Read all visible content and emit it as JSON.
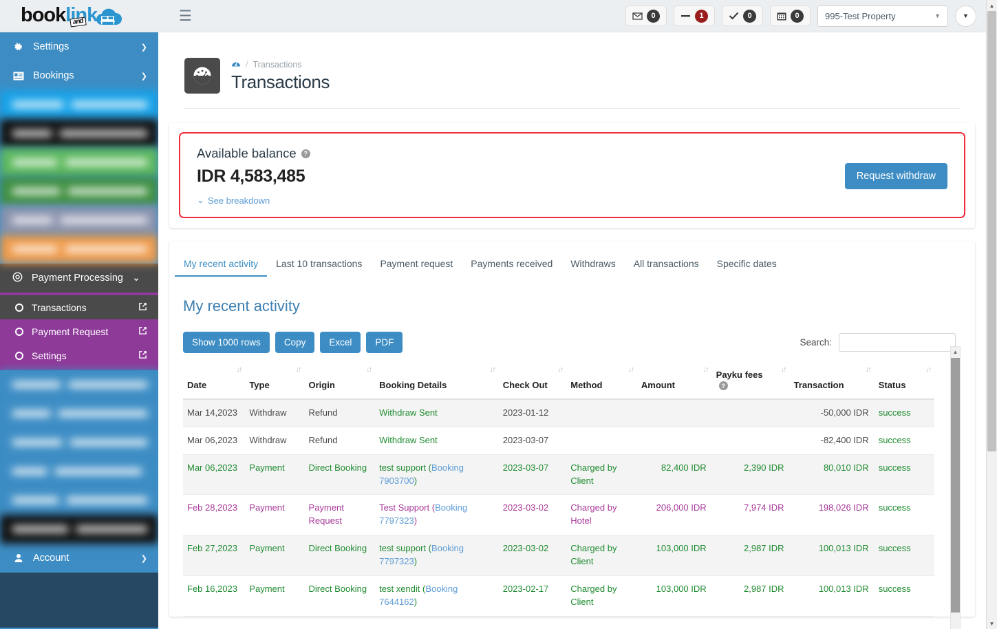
{
  "brand": {
    "book": "book",
    "and": "and",
    "link": "link"
  },
  "topbar": {
    "menu_icon": "hamburger-icon",
    "stats": [
      {
        "icon": "envelope-icon",
        "glyph": "✉",
        "count": "0",
        "style": "dark"
      },
      {
        "icon": "minus-icon",
        "glyph": "➖",
        "count": "1",
        "style": "red"
      },
      {
        "icon": "check-icon",
        "glyph": "✔",
        "count": "0",
        "style": "dark"
      },
      {
        "icon": "calendar-icon",
        "glyph": "Ὄ5",
        "count": "0",
        "style": "dark"
      }
    ],
    "property": {
      "value": "995-Test Property",
      "caret": "▼"
    },
    "extra_button_caret": "▼"
  },
  "sidebar": {
    "items": [
      {
        "label": "Settings",
        "icon": "gear-icon",
        "arrow": "❯"
      },
      {
        "label": "Bookings",
        "icon": "id-card-icon",
        "arrow": "❯"
      }
    ],
    "redacted_top": [
      {
        "bg": "#17a2e8",
        "w1": 78,
        "w2": 116
      },
      {
        "bg": "#111111",
        "w1": 62,
        "w2": 138
      },
      {
        "bg": "#5cb85c",
        "w1": 70,
        "w2": 128
      },
      {
        "bg": "#3f8f3f",
        "w1": 74,
        "w2": 122
      },
      {
        "bg": "#8b93ad",
        "w1": 60,
        "w2": 130
      },
      {
        "bg": "#ef9a4a",
        "w1": 66,
        "w2": 120
      }
    ],
    "group": {
      "label": "Payment Processing",
      "icon": "target-icon",
      "chevron": "⌄",
      "items": [
        {
          "label": "Transactions",
          "active": true,
          "ext_icon": "external-link-icon"
        },
        {
          "label": "Payment Request",
          "active": false,
          "ext_icon": "external-link-icon"
        },
        {
          "label": "Settings",
          "active": false,
          "ext_icon": "external-link-icon"
        }
      ]
    },
    "redacted_bottom": [
      {
        "bg": "#3d8dc4",
        "w1": 72,
        "w2": 118
      },
      {
        "bg": "#3d8dc4",
        "w1": 56,
        "w2": 132
      },
      {
        "bg": "#3d8dc4",
        "w1": 80,
        "w2": 124
      },
      {
        "bg": "#3d8dc4",
        "w1": 50,
        "w2": 126
      },
      {
        "bg": "#3d8dc4",
        "w1": 68,
        "w2": 120
      },
      {
        "bg": "#111111",
        "w1": 86,
        "w2": 110
      }
    ],
    "account": {
      "label": "Account",
      "icon": "user-icon",
      "arrow": "❯"
    }
  },
  "page": {
    "icon": "speedometer-icon",
    "breadcrumb_home_icon": "dashboard-icon",
    "breadcrumb_separator": "/",
    "breadcrumb": "Transactions",
    "title": "Transactions"
  },
  "balance": {
    "label": "Available balance",
    "help_icon": "help-circle-icon",
    "currency": "IDR",
    "amount": "4,583,485",
    "breakdown_label": "See breakdown",
    "breakdown_caret": "⌄",
    "withdraw_button": "Request withdraw",
    "border_color": "#ef2d3c"
  },
  "tabs": [
    {
      "label": "My recent activity",
      "active": true
    },
    {
      "label": "Last 10 transactions",
      "active": false
    },
    {
      "label": "Payment request",
      "active": false
    },
    {
      "label": "Payments received",
      "active": false
    },
    {
      "label": "Withdraws",
      "active": false
    },
    {
      "label": "All transactions",
      "active": false
    },
    {
      "label": "Specific dates",
      "active": false
    }
  ],
  "section": {
    "title": "My recent activity",
    "buttons": [
      "Show 1000 rows",
      "Copy",
      "Excel",
      "PDF"
    ],
    "search_label": "Search:",
    "search_value": "",
    "search_placeholder": ""
  },
  "table": {
    "columns": [
      {
        "label": "Date",
        "align": "left"
      },
      {
        "label": "Type",
        "align": "left"
      },
      {
        "label": "Origin",
        "align": "left"
      },
      {
        "label": "Booking Details",
        "align": "left"
      },
      {
        "label": "Check Out",
        "align": "left"
      },
      {
        "label": "Method",
        "align": "left"
      },
      {
        "label": "Amount",
        "align": "right"
      },
      {
        "label": "Payku fees",
        "align": "left",
        "help_icon": "help-circle-icon"
      },
      {
        "label": "Transaction",
        "align": "right"
      },
      {
        "label": "Status",
        "align": "left"
      }
    ],
    "sort_glyph": "↓↑",
    "rows": [
      {
        "date": "Mar 14,2023",
        "type": "Withdraw",
        "origin": "Refund",
        "booking_text": "Withdraw Sent",
        "booking_link": "",
        "booking_suffix": "",
        "checkout": "2023-01-12",
        "method": "",
        "amount": "",
        "fees": "",
        "transaction": "-50,000 IDR",
        "status": "success",
        "color": "#4a4a4a",
        "booking_color": "#1e8b2f",
        "alt": true
      },
      {
        "date": "Mar 06,2023",
        "type": "Withdraw",
        "origin": "Refund",
        "booking_text": "Withdraw Sent",
        "booking_link": "",
        "booking_suffix": "",
        "checkout": "2023-03-07",
        "method": "",
        "amount": "",
        "fees": "",
        "transaction": "-82,400 IDR",
        "status": "success",
        "color": "#4a4a4a",
        "booking_color": "#1e8b2f",
        "alt": false
      },
      {
        "date": "Mar 06,2023",
        "type": "Payment",
        "origin": "Direct Booking",
        "booking_text": "test support (",
        "booking_link": "Booking 7903700",
        "booking_suffix": ")",
        "checkout": "2023-03-07",
        "method": "Charged by Client",
        "amount": "82,400 IDR",
        "fees": "2,390 IDR",
        "transaction": "80,010 IDR",
        "status": "success",
        "color": "#1e8b2f",
        "booking_color": "#1e8b2f",
        "alt": true
      },
      {
        "date": "Feb 28,2023",
        "type": "Payment",
        "origin": "Payment Request",
        "booking_text": "Test Support (",
        "booking_link": "Booking 7797323",
        "booking_suffix": ")",
        "checkout": "2023-03-02",
        "method": "Charged by Hotel",
        "amount": "206,000 IDR",
        "fees": "7,974 IDR",
        "transaction": "198,026 IDR",
        "status": "success",
        "color": "#a8399b",
        "booking_color": "#a8399b",
        "alt": false
      },
      {
        "date": "Feb 27,2023",
        "type": "Payment",
        "origin": "Direct Booking",
        "booking_text": "test support (",
        "booking_link": "Booking 7797323",
        "booking_suffix": ")",
        "checkout": "2023-03-02",
        "method": "Charged by Client",
        "amount": "103,000 IDR",
        "fees": "2,987 IDR",
        "transaction": "100,013 IDR",
        "status": "success",
        "color": "#1e8b2f",
        "booking_color": "#1e8b2f",
        "alt": true
      },
      {
        "date": "Feb 16,2023",
        "type": "Payment",
        "origin": "Direct Booking",
        "booking_text": "test xendit (",
        "booking_link": "Booking 7644162",
        "booking_suffix": ")",
        "checkout": "2023-02-17",
        "method": "Charged by Client",
        "amount": "103,000 IDR",
        "fees": "2,987 IDR",
        "transaction": "100,013 IDR",
        "status": "success",
        "color": "#1e8b2f",
        "booking_color": "#1e8b2f",
        "alt": false
      }
    ]
  }
}
